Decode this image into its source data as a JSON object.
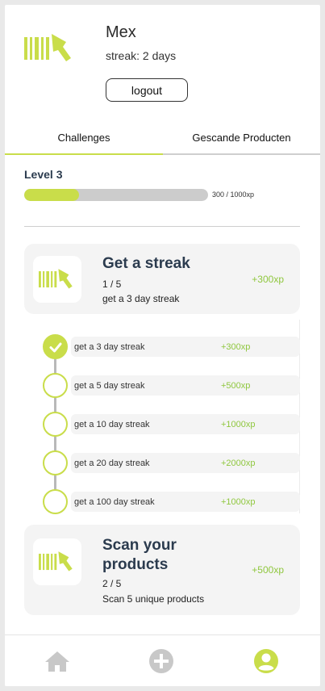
{
  "colors": {
    "accent": "#c9dd4a",
    "reward": "#8fc73e",
    "title": "#2b3b4e",
    "muted_icon": "#c8c8c8"
  },
  "profile": {
    "logo_icon": "barcode-scanner-icon",
    "username": "Mex",
    "streak": "streak: 2 days",
    "logout_label": "logout"
  },
  "tabs": [
    {
      "label": "Challenges",
      "active": true
    },
    {
      "label": "Gescande Producten",
      "active": false
    }
  ],
  "level": {
    "title": "Level 3",
    "xp_text": "300 / 1000xp",
    "progress": 0.3
  },
  "challenges": [
    {
      "icon": "barcode-scanner-icon",
      "title": "Get a streak",
      "progress": "1 / 5",
      "description": "get a 3 day streak",
      "reward": "+300xp",
      "steps": [
        {
          "label": "get a 3 day streak",
          "xp": "+300xp",
          "done": true
        },
        {
          "label": "get a 5 day streak",
          "xp": "+500xp",
          "done": false
        },
        {
          "label": "get a 10 day streak",
          "xp": "+1000xp",
          "done": false
        },
        {
          "label": "get a 20 day streak",
          "xp": "+2000xp",
          "done": false
        },
        {
          "label": "get a 100 day streak",
          "xp": "+1000xp",
          "done": false
        }
      ]
    },
    {
      "icon": "barcode-scanner-icon",
      "title": "Scan your products",
      "progress": "2 / 5",
      "description": "Scan 5 unique products",
      "reward": "+500xp"
    }
  ],
  "nav": [
    {
      "icon": "home-icon",
      "active": false
    },
    {
      "icon": "add-circle-icon",
      "active": false
    },
    {
      "icon": "profile-icon",
      "active": true
    }
  ]
}
